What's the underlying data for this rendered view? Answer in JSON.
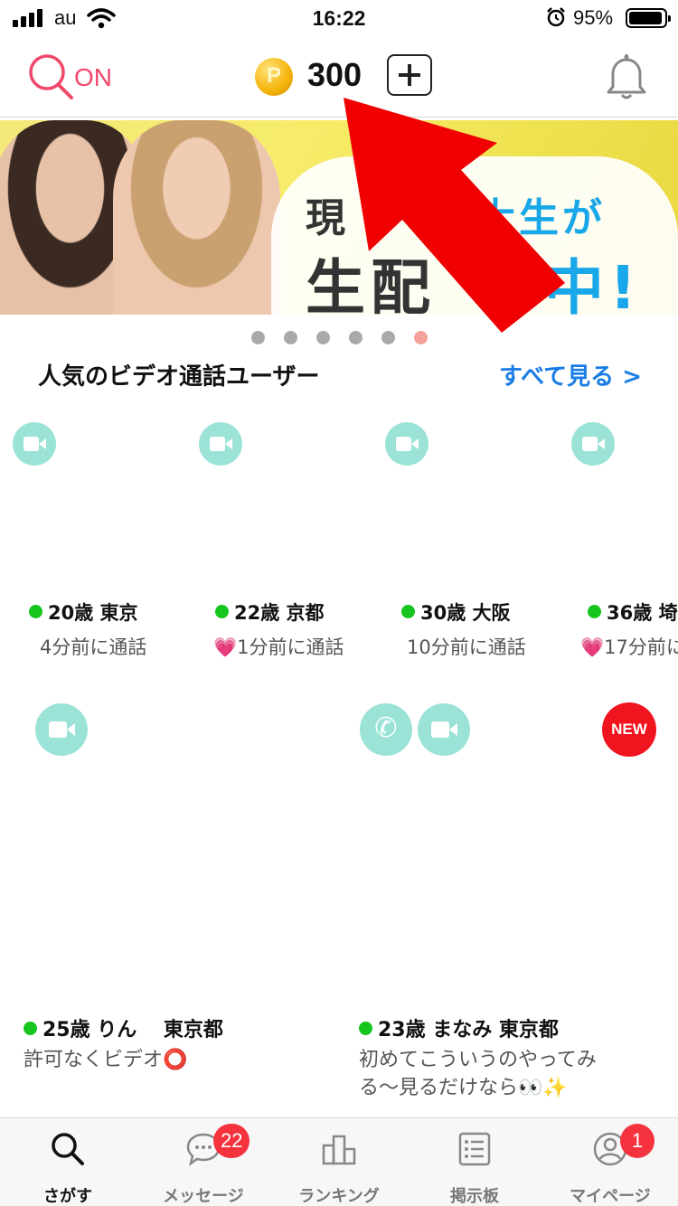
{
  "status_bar": {
    "carrier": "au",
    "time": "16:22",
    "battery_percent": "95%"
  },
  "header": {
    "search_status": "ON",
    "points": "300",
    "coin_glyph": "P"
  },
  "banner": {
    "line1_a": "現",
    "line1_b": "大生が",
    "line2_a": "生配",
    "line2_b": "中!"
  },
  "carousel": {
    "total": 6,
    "active_index": 5
  },
  "popular": {
    "title": "人気のビデオ通話ユーザー",
    "see_all": "すべて見る >",
    "users": [
      {
        "info": "20歳 東京",
        "last_call": "4分前に通話",
        "heart": false
      },
      {
        "info": "22歳 京都",
        "last_call": "1分前に通話",
        "heart": true
      },
      {
        "info": "30歳 大阪",
        "last_call": "10分前に通話",
        "heart": false
      },
      {
        "info": "36歳 埼",
        "last_call": "17分前に",
        "heart": true
      }
    ]
  },
  "cards": [
    {
      "name": "25歳 りん　 東京都",
      "desc": "許可なくビデオ⭕"
    },
    {
      "name": "23歳 まなみ 東京都",
      "desc": "初めてこういうのやってみる〜見るだけなら👀✨",
      "badge": "NEW"
    }
  ],
  "tabs": [
    {
      "label": "さがす",
      "icon": "search-icon",
      "active": true
    },
    {
      "label": "メッセージ",
      "icon": "chat-icon",
      "badge": "22"
    },
    {
      "label": "ランキング",
      "icon": "podium-icon"
    },
    {
      "label": "掲示板",
      "icon": "board-icon"
    },
    {
      "label": "マイページ",
      "icon": "profile-icon",
      "badge": "1"
    }
  ],
  "colors": {
    "accent_pink": "#f0486b",
    "link_blue": "#1a7de6",
    "online_green": "#16c51e",
    "badge_red": "#f5333f",
    "video_badge": "#9be3d7"
  }
}
